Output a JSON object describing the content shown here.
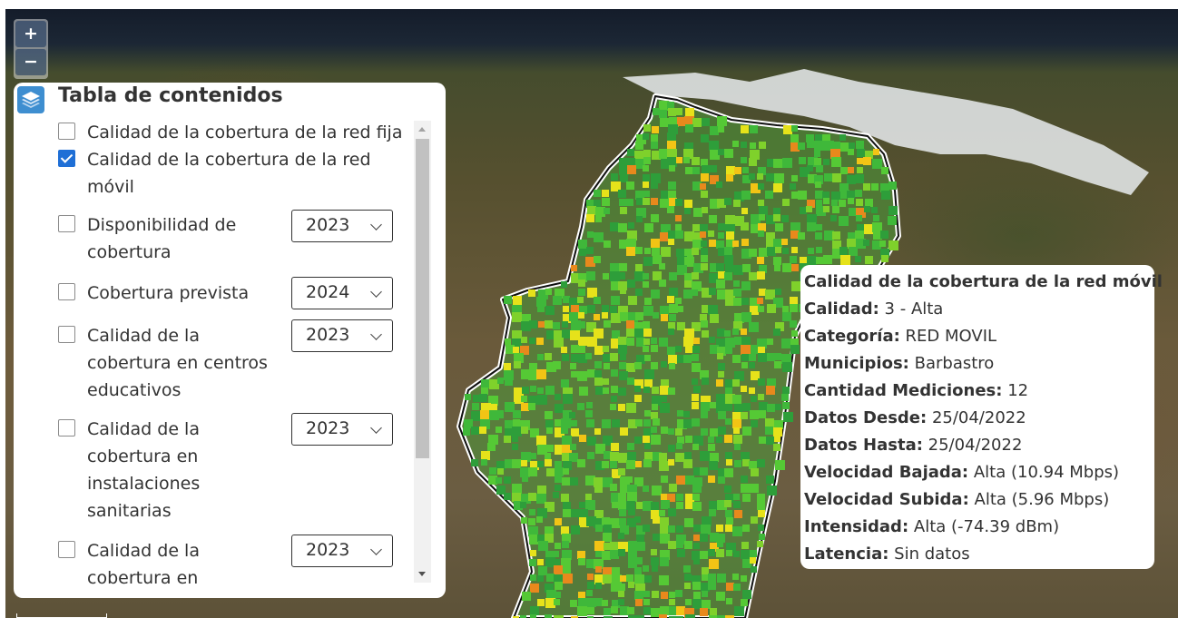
{
  "zoom": {
    "in_label": "+",
    "out_label": "−"
  },
  "toc": {
    "title": "Tabla de contenidos",
    "items": [
      {
        "label_lines": [
          "Calidad de la cobertura de la red fija"
        ],
        "checked": false
      },
      {
        "label_lines": [
          "Calidad de la cobertura de la red",
          "móvil"
        ],
        "checked": true
      },
      {
        "label_lines": [
          "Disponibilidad de",
          "cobertura"
        ],
        "checked": false,
        "year": "2023"
      },
      {
        "label_lines": [
          "Cobertura prevista"
        ],
        "checked": false,
        "year": "2024"
      },
      {
        "label_lines": [
          "Calidad de la",
          "cobertura en centros",
          "educativos"
        ],
        "checked": false,
        "year": "2023"
      },
      {
        "label_lines": [
          "Calidad de la",
          "cobertura en",
          "instalaciones",
          "sanitarias"
        ],
        "checked": false,
        "year": "2023"
      },
      {
        "label_lines": [
          "Calidad de la",
          "cobertura en"
        ],
        "checked": false,
        "year": "2023"
      }
    ]
  },
  "popup": {
    "title": "Calidad de la cobertura de la red móvil",
    "fields": [
      {
        "label": "Calidad:",
        "value": "3 - Alta"
      },
      {
        "label": "Categoría:",
        "value": "RED MOVIL"
      },
      {
        "label": "Municipios:",
        "value": "Barbastro"
      },
      {
        "label": "Cantidad Mediciones:",
        "value": "12"
      },
      {
        "label": "Datos Desde:",
        "value": "25/04/2022"
      },
      {
        "label": "Datos Hasta:",
        "value": "25/04/2022"
      },
      {
        "label": "Velocidad Bajada:",
        "value": "Alta (10.94 Mbps)"
      },
      {
        "label": "Velocidad Subida:",
        "value": "Alta (5.96 Mbps)"
      },
      {
        "label": "Intensidad:",
        "value": "Alta (-74.39 dBm)"
      },
      {
        "label": "Latencia:",
        "value": "Sin datos"
      }
    ]
  },
  "map": {
    "coverage_colors": [
      "#2e9e3a",
      "#3fb83a",
      "#55c935",
      "#7fd12b",
      "#e6e21a",
      "#f2c415",
      "#e8891c"
    ],
    "outline_color": "#ffffff"
  }
}
